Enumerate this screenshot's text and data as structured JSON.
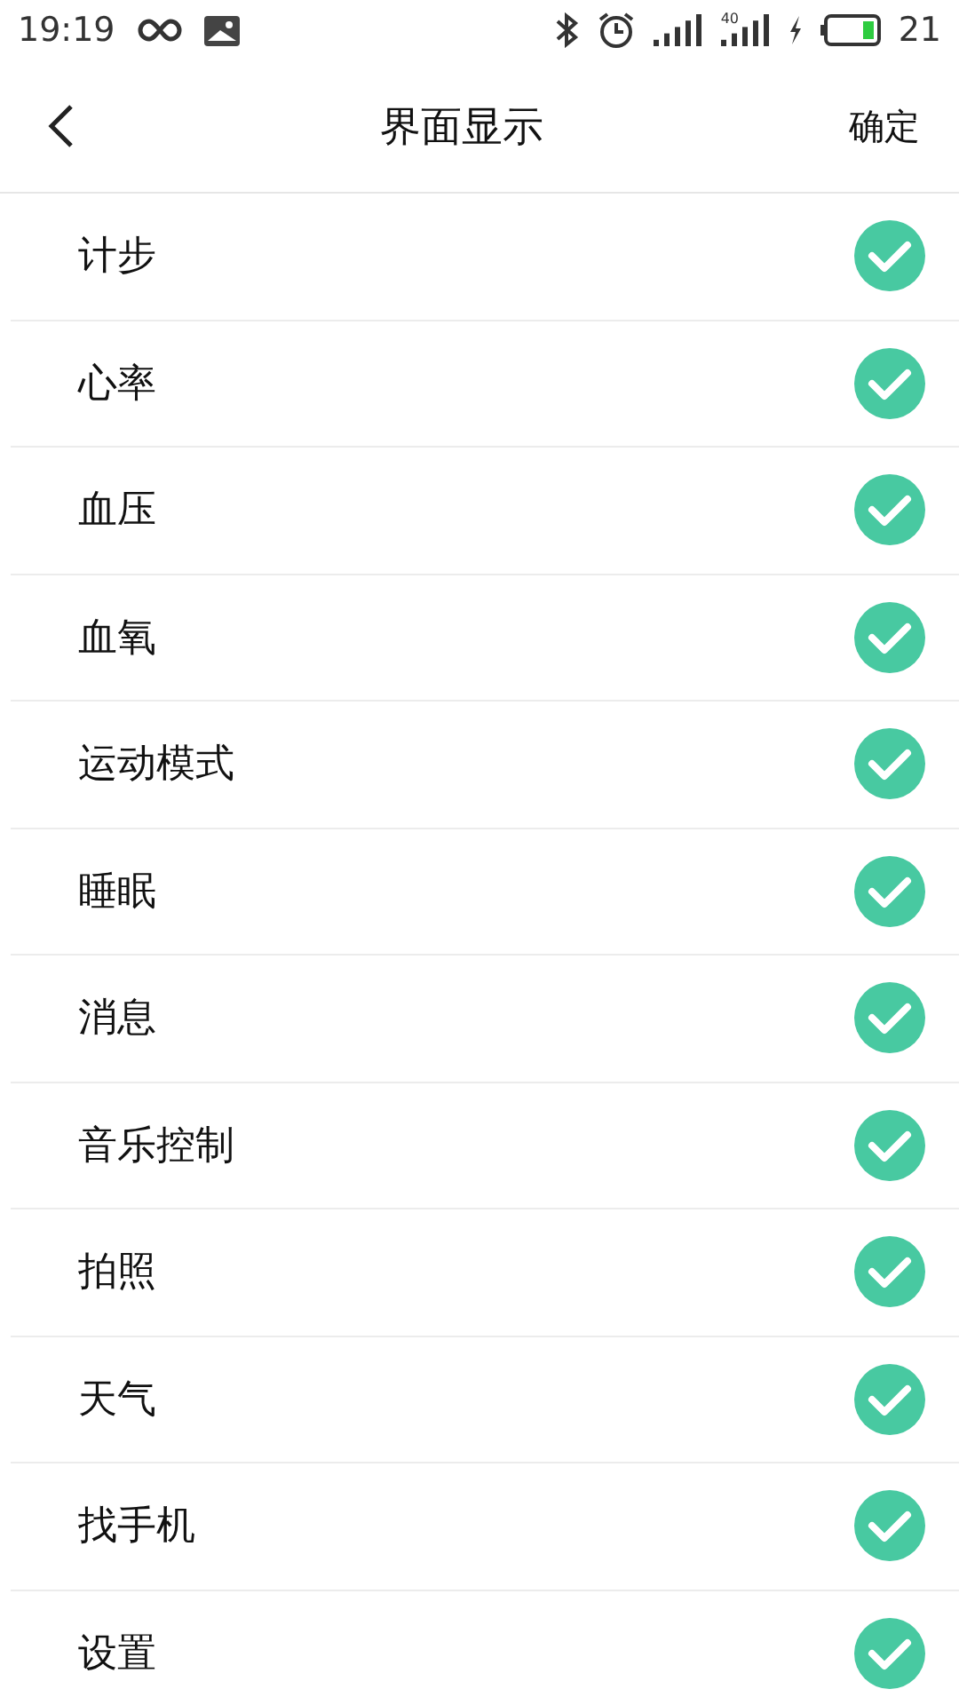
{
  "status_bar": {
    "time": "19:19",
    "network_label": "40",
    "battery": "21"
  },
  "nav": {
    "title": "界面显示",
    "action": "确定"
  },
  "items": [
    {
      "label": "计步",
      "checked": true
    },
    {
      "label": "心率",
      "checked": true
    },
    {
      "label": "血压",
      "checked": true
    },
    {
      "label": "血氧",
      "checked": true
    },
    {
      "label": "运动模式",
      "checked": true
    },
    {
      "label": "睡眠",
      "checked": true
    },
    {
      "label": "消息",
      "checked": true
    },
    {
      "label": "音乐控制",
      "checked": true
    },
    {
      "label": "拍照",
      "checked": true
    },
    {
      "label": "天气",
      "checked": true
    },
    {
      "label": "找手机",
      "checked": true
    },
    {
      "label": "设置",
      "checked": true
    }
  ]
}
